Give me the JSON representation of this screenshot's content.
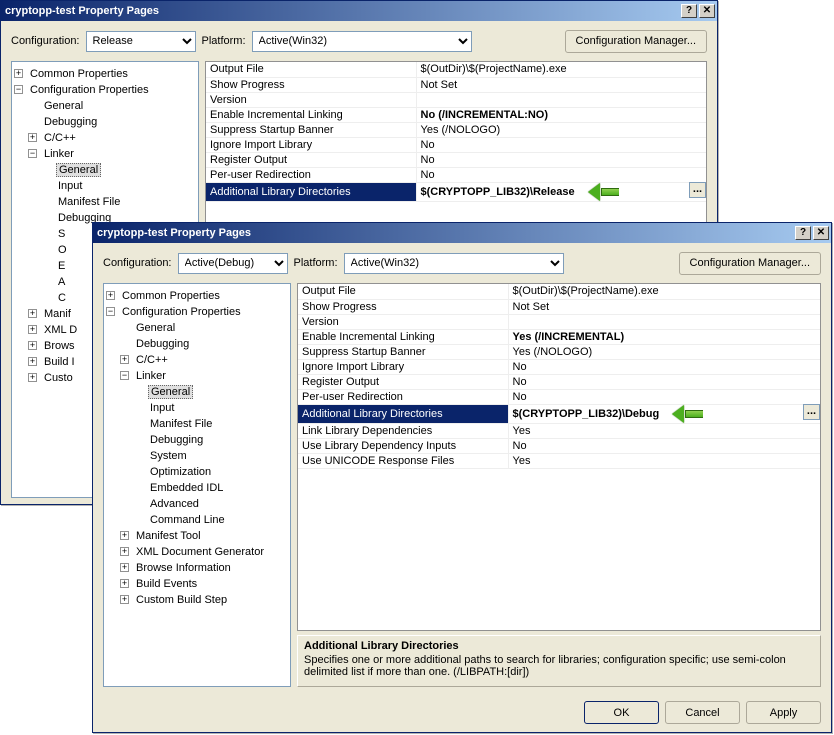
{
  "window1": {
    "title": "cryptopp-test Property Pages",
    "config_label": "Configuration:",
    "config_value": "Release",
    "platform_label": "Platform:",
    "platform_value": "Active(Win32)",
    "cfgmgr": "Configuration Manager...",
    "tree": {
      "common": "Common Properties",
      "configprops": "Configuration Properties",
      "general": "General",
      "debugging": "Debugging",
      "ccpp": "C/C++",
      "linker": "Linker",
      "l_general": "General",
      "l_input": "Input",
      "l_manifest": "Manifest File",
      "l_debugging": "Debugging",
      "l_s": "S",
      "l_o": "O",
      "l_e": "E",
      "l_a": "A",
      "l_c": "C",
      "manif": "Manif",
      "xmld": "XML D",
      "brows": "Brows",
      "build": "Build I",
      "custo": "Custo"
    },
    "props": {
      "output_file": {
        "k": "Output File",
        "v": "$(OutDir)\\$(ProjectName).exe"
      },
      "show_progress": {
        "k": "Show Progress",
        "v": "Not Set"
      },
      "version": {
        "k": "Version",
        "v": ""
      },
      "incremental": {
        "k": "Enable Incremental Linking",
        "v": "No (/INCREMENTAL:NO)"
      },
      "banner": {
        "k": "Suppress Startup Banner",
        "v": "Yes (/NOLOGO)"
      },
      "ignore_import": {
        "k": "Ignore Import Library",
        "v": "No"
      },
      "register_output": {
        "k": "Register Output",
        "v": "No"
      },
      "per_user": {
        "k": "Per-user Redirection",
        "v": "No"
      },
      "addlib": {
        "k": "Additional Library Directories",
        "v": "$(CRYPTOPP_LIB32)\\Release"
      }
    }
  },
  "window2": {
    "title": "cryptopp-test Property Pages",
    "config_label": "Configuration:",
    "config_value": "Active(Debug)",
    "platform_label": "Platform:",
    "platform_value": "Active(Win32)",
    "cfgmgr": "Configuration Manager...",
    "tree": {
      "common": "Common Properties",
      "configprops": "Configuration Properties",
      "general": "General",
      "debugging": "Debugging",
      "ccpp": "C/C++",
      "linker": "Linker",
      "l_general": "General",
      "l_input": "Input",
      "l_manifest": "Manifest File",
      "l_debugging": "Debugging",
      "l_system": "System",
      "l_optimization": "Optimization",
      "l_embeddedidl": "Embedded IDL",
      "l_advanced": "Advanced",
      "l_cmdline": "Command Line",
      "manifest_tool": "Manifest Tool",
      "xml_doc": "XML Document Generator",
      "browse_info": "Browse Information",
      "build_events": "Build Events",
      "custom_build": "Custom Build Step"
    },
    "props": {
      "output_file": {
        "k": "Output File",
        "v": "$(OutDir)\\$(ProjectName).exe"
      },
      "show_progress": {
        "k": "Show Progress",
        "v": "Not Set"
      },
      "version": {
        "k": "Version",
        "v": ""
      },
      "incremental": {
        "k": "Enable Incremental Linking",
        "v": "Yes (/INCREMENTAL)"
      },
      "banner": {
        "k": "Suppress Startup Banner",
        "v": "Yes (/NOLOGO)"
      },
      "ignore_import": {
        "k": "Ignore Import Library",
        "v": "No"
      },
      "register_output": {
        "k": "Register Output",
        "v": "No"
      },
      "per_user": {
        "k": "Per-user Redirection",
        "v": "No"
      },
      "addlib": {
        "k": "Additional Library Directories",
        "v": "$(CRYPTOPP_LIB32)\\Debug"
      },
      "link_lib_deps": {
        "k": "Link Library Dependencies",
        "v": "Yes"
      },
      "use_lib_dep_inputs": {
        "k": "Use Library Dependency Inputs",
        "v": "No"
      },
      "use_unicode": {
        "k": "Use UNICODE Response Files",
        "v": "Yes"
      }
    },
    "desc": {
      "title": "Additional Library Directories",
      "text": "Specifies one or more additional paths to search for libraries; configuration specific; use semi-colon delimited list if more than one.     (/LIBPATH:[dir])"
    },
    "buttons": {
      "ok": "OK",
      "cancel": "Cancel",
      "apply": "Apply"
    }
  }
}
